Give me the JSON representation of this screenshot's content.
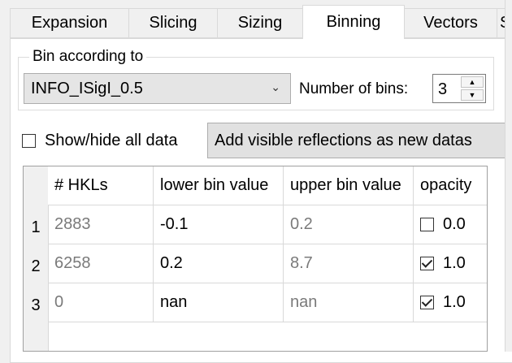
{
  "tabs": [
    {
      "label": "Expansion"
    },
    {
      "label": "Slicing"
    },
    {
      "label": "Sizing"
    },
    {
      "label": "Binning"
    },
    {
      "label": "Vectors"
    },
    {
      "label": "S"
    }
  ],
  "active_tab": "Binning",
  "bin_group": {
    "title": "Bin according to",
    "selected_option": "INFO_ISigI_0.5",
    "num_bins_label": "Number of bins:",
    "num_bins_value": "3"
  },
  "show_hide": {
    "label": "Show/hide all data",
    "checked": false
  },
  "add_button": {
    "label": "Add visible reflections as new datas"
  },
  "table": {
    "headers": [
      "# HKLs",
      "lower bin value",
      "upper bin value",
      "opacity"
    ],
    "rows": [
      {
        "index": "1",
        "hkls": "2883",
        "lower": "-0.1",
        "upper": "0.2",
        "opacity": "0.0",
        "checked": false
      },
      {
        "index": "2",
        "hkls": "6258",
        "lower": "0.2",
        "upper": "8.7",
        "opacity": "1.0",
        "checked": true
      },
      {
        "index": "3",
        "hkls": "0",
        "lower": "nan",
        "upper": "nan",
        "opacity": "1.0",
        "checked": true
      }
    ]
  }
}
